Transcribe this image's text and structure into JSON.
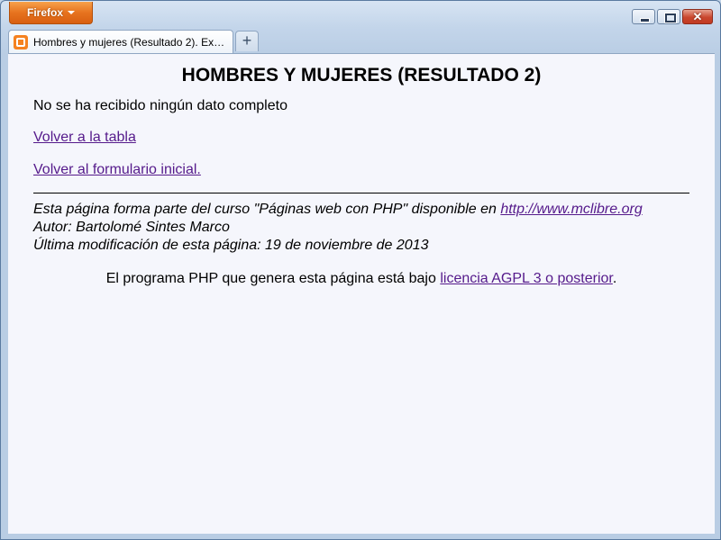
{
  "browser": {
    "menu_button": "Firefox",
    "tab_title": "Hombres y mujeres (Resultado 2). Exám...",
    "new_tab_symbol": "+",
    "close_symbol": "✕"
  },
  "page": {
    "heading": "HOMBRES Y MUJERES (RESULTADO 2)",
    "message": "No se ha recibido ningún dato completo",
    "back_to_table": "Volver a la tabla",
    "back_to_form": "Volver al formulario inicial.",
    "footer": {
      "course_prefix": "Esta página forma parte del curso \"Páginas web con PHP\" disponible en ",
      "course_link": "http://www.mclibre.org",
      "author": "Autor: Bartolomé Sintes Marco",
      "modified": "Última modificación de esta página: 19 de noviembre de 2013"
    },
    "license": {
      "prefix": "El programa PHP que genera esta página está bajo ",
      "link": "licencia AGPL 3 o posterior",
      "suffix": "."
    }
  },
  "colors": {
    "link_visited": "#551a8b",
    "page_background": "#f5f6fc",
    "firefox_orange": "#e7731f"
  }
}
